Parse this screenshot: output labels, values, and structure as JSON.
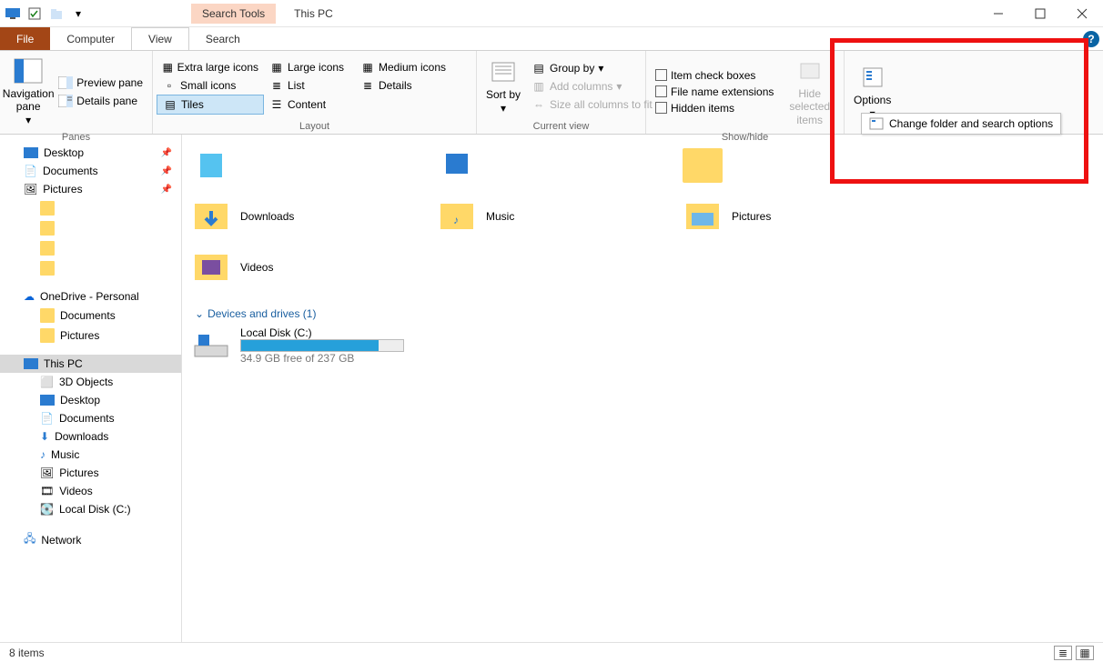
{
  "titlebar": {
    "search_tools": "Search Tools",
    "title": "This PC"
  },
  "tabs": {
    "file": "File",
    "computer": "Computer",
    "view": "View",
    "search": "Search"
  },
  "ribbon": {
    "panes": {
      "navigation": "Navigation pane",
      "preview": "Preview pane",
      "details": "Details pane",
      "label": "Panes"
    },
    "layout": {
      "extra_large": "Extra large icons",
      "large": "Large icons",
      "medium": "Medium icons",
      "small": "Small icons",
      "list": "List",
      "details": "Details",
      "tiles": "Tiles",
      "content": "Content",
      "label": "Layout"
    },
    "current_view": {
      "sort": "Sort by",
      "group": "Group by",
      "add_cols": "Add columns",
      "size_cols": "Size all columns to fit",
      "label": "Current view"
    },
    "show_hide": {
      "item_check": "Item check boxes",
      "file_ext": "File name extensions",
      "hidden": "Hidden items",
      "hide_sel": "Hide selected items",
      "label": "Show/hide"
    },
    "options": {
      "label": "Options",
      "change": "Change folder and search options"
    }
  },
  "tree": {
    "desktop": "Desktop",
    "documents": "Documents",
    "pictures": "Pictures",
    "onedrive": "OneDrive - Personal",
    "od_documents": "Documents",
    "od_pictures": "Pictures",
    "this_pc": "This PC",
    "objects3d": "3D Objects",
    "pc_desktop": "Desktop",
    "pc_documents": "Documents",
    "pc_downloads": "Downloads",
    "pc_music": "Music",
    "pc_pictures": "Pictures",
    "pc_videos": "Videos",
    "local_disk": "Local Disk (C:)",
    "network": "Network"
  },
  "content": {
    "downloads": "Downloads",
    "music": "Music",
    "pictures": "Pictures",
    "videos": "Videos",
    "devices_hdr": "Devices and drives (1)",
    "local_disk": "Local Disk (C:)",
    "disk_free": "34.9 GB free of 237 GB"
  },
  "status": {
    "items": "8 items"
  }
}
